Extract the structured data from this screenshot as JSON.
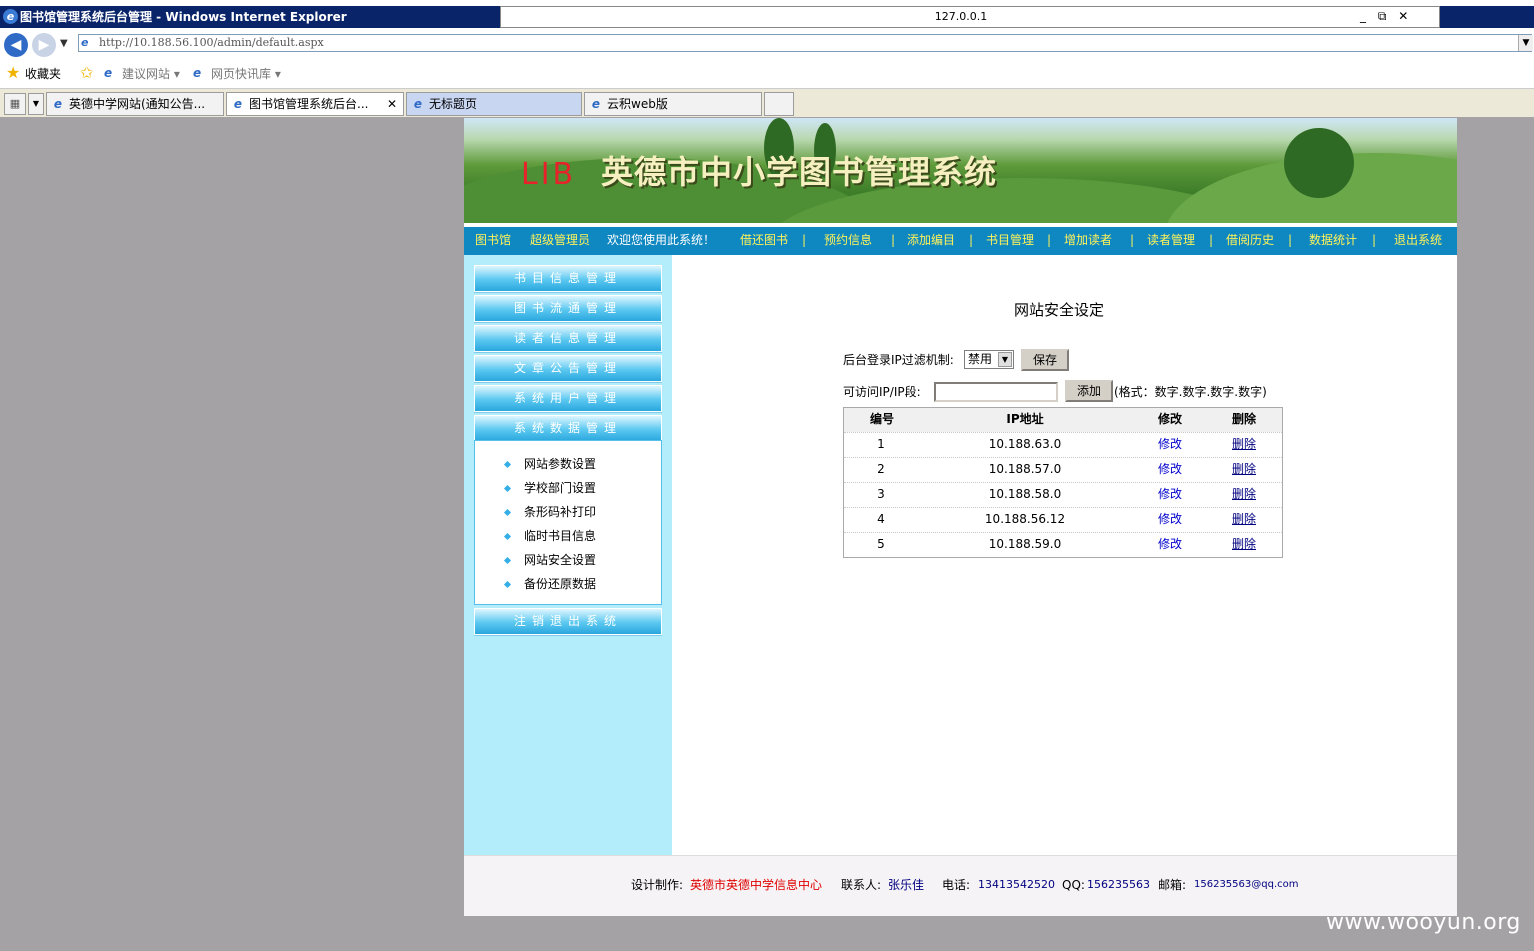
{
  "window": {
    "title": "图书馆管理系统后台管理 - Windows Internet Explorer",
    "tab_host": "127.0.0.1",
    "controls": [
      "_",
      "⧉",
      "✕"
    ]
  },
  "browser": {
    "address": "http://10.188.56.100/admin/default.aspx",
    "favorites_label": "收藏夹",
    "fav_links": [
      "建议网站 ▾",
      "网页快讯库 ▾"
    ],
    "tabs": [
      {
        "label": "英德中学网站(通知公告..."
      },
      {
        "label": "图书馆管理系统后台..."
      },
      {
        "label": "无标题页"
      },
      {
        "label": "云积web版"
      }
    ],
    "tab_close": "✕"
  },
  "banner": {
    "lib": "LIB",
    "title": "英德市中小学图书管理系统"
  },
  "nav": {
    "library": "图书馆",
    "admin": "超级管理员",
    "welcome": "欢迎您使用此系统！",
    "items": [
      "借还图书",
      "预约信息",
      "添加编目",
      "书目管理",
      "增加读者",
      "读者管理",
      "借阅历史",
      "数据统计",
      "退出系统"
    ],
    "sep": "|"
  },
  "sidebar": {
    "menus": [
      "书目信息管理",
      "图书流通管理",
      "读者信息管理",
      "文章公告管理",
      "系统用户管理",
      "系统数据管理"
    ],
    "subitems": [
      "网站参数设置",
      "学校部门设置",
      "条形码补打印",
      "临时书目信息",
      "网站安全设置",
      "备份还原数据"
    ],
    "logout": "注销退出系统"
  },
  "content": {
    "title": "网站安全设定",
    "filter_label": "后台登录IP过滤机制:",
    "filter_value": "禁用",
    "save_label": "保存",
    "ip_label": "可访问IP/IP段:",
    "ip_value": "",
    "add_label": "添加",
    "format_hint": "(格式：数字.数字.数字.数字)",
    "table": {
      "headers": [
        "编号",
        "IP地址",
        "修改",
        "删除"
      ],
      "rows": [
        {
          "id": "1",
          "ip": "10.188.63.0",
          "edit": "修改",
          "del": "删除"
        },
        {
          "id": "2",
          "ip": "10.188.57.0",
          "edit": "修改",
          "del": "删除"
        },
        {
          "id": "3",
          "ip": "10.188.58.0",
          "edit": "修改",
          "del": "删除"
        },
        {
          "id": "4",
          "ip": "10.188.56.12",
          "edit": "修改",
          "del": "删除"
        },
        {
          "id": "5",
          "ip": "10.188.59.0",
          "edit": "修改",
          "del": "删除"
        }
      ]
    }
  },
  "footer": {
    "design_label": "设计制作:",
    "design_value": "英德市英德中学信息中心",
    "contact_label": "联系人:",
    "contact_value": "张乐佳",
    "phone_label": "电话:",
    "phone_value": "13413542520",
    "qq_label": "QQ:",
    "qq_value": "156235563",
    "email_label": "邮箱:",
    "email_value": "156235563@qq.com"
  },
  "watermark": "www.wooyun.org",
  "colors": {
    "nav_bg": "#0f87c0",
    "nav_text": "#fff35a",
    "sidebar_bg": "#b3ecfb",
    "title_bar": "#0a246a"
  }
}
